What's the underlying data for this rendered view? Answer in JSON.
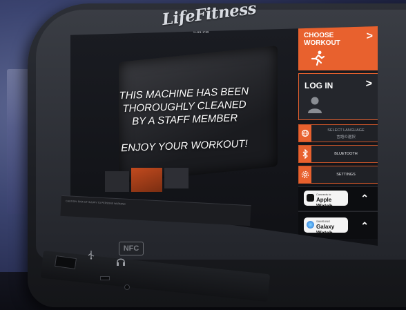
{
  "brand": {
    "logo_text": "LifeFitness"
  },
  "screen": {
    "clock": "4:34 PM",
    "message_lines": [
      "THIS MACHINE HAS BEEN",
      "THOROUGHLY CLEANED",
      "BY A STAFF MEMBER"
    ],
    "enjoy": "ENJOY YOUR WORKOUT!"
  },
  "panel": {
    "choose_workout": "CHOOSE WORKOUT",
    "log_in": "LOG IN",
    "select_language": "SELECT LANGUAGE",
    "select_language_ja": "言語の選択",
    "bluetooth": "BLUETOOTH",
    "settings": "SETTINGS",
    "apple_watch_small": "Connects to",
    "apple_watch": "Apple Watch",
    "galaxy_small": "SAMSUNG",
    "galaxy_watch": "Galaxy Watch"
  },
  "console": {
    "nfc": "NFC",
    "warning_text": "CAUTION: RISK OF INJURY TO PERSONS  WARNING"
  },
  "colors": {
    "accent": "#e8612e",
    "panel_dark": "#1f2126"
  }
}
